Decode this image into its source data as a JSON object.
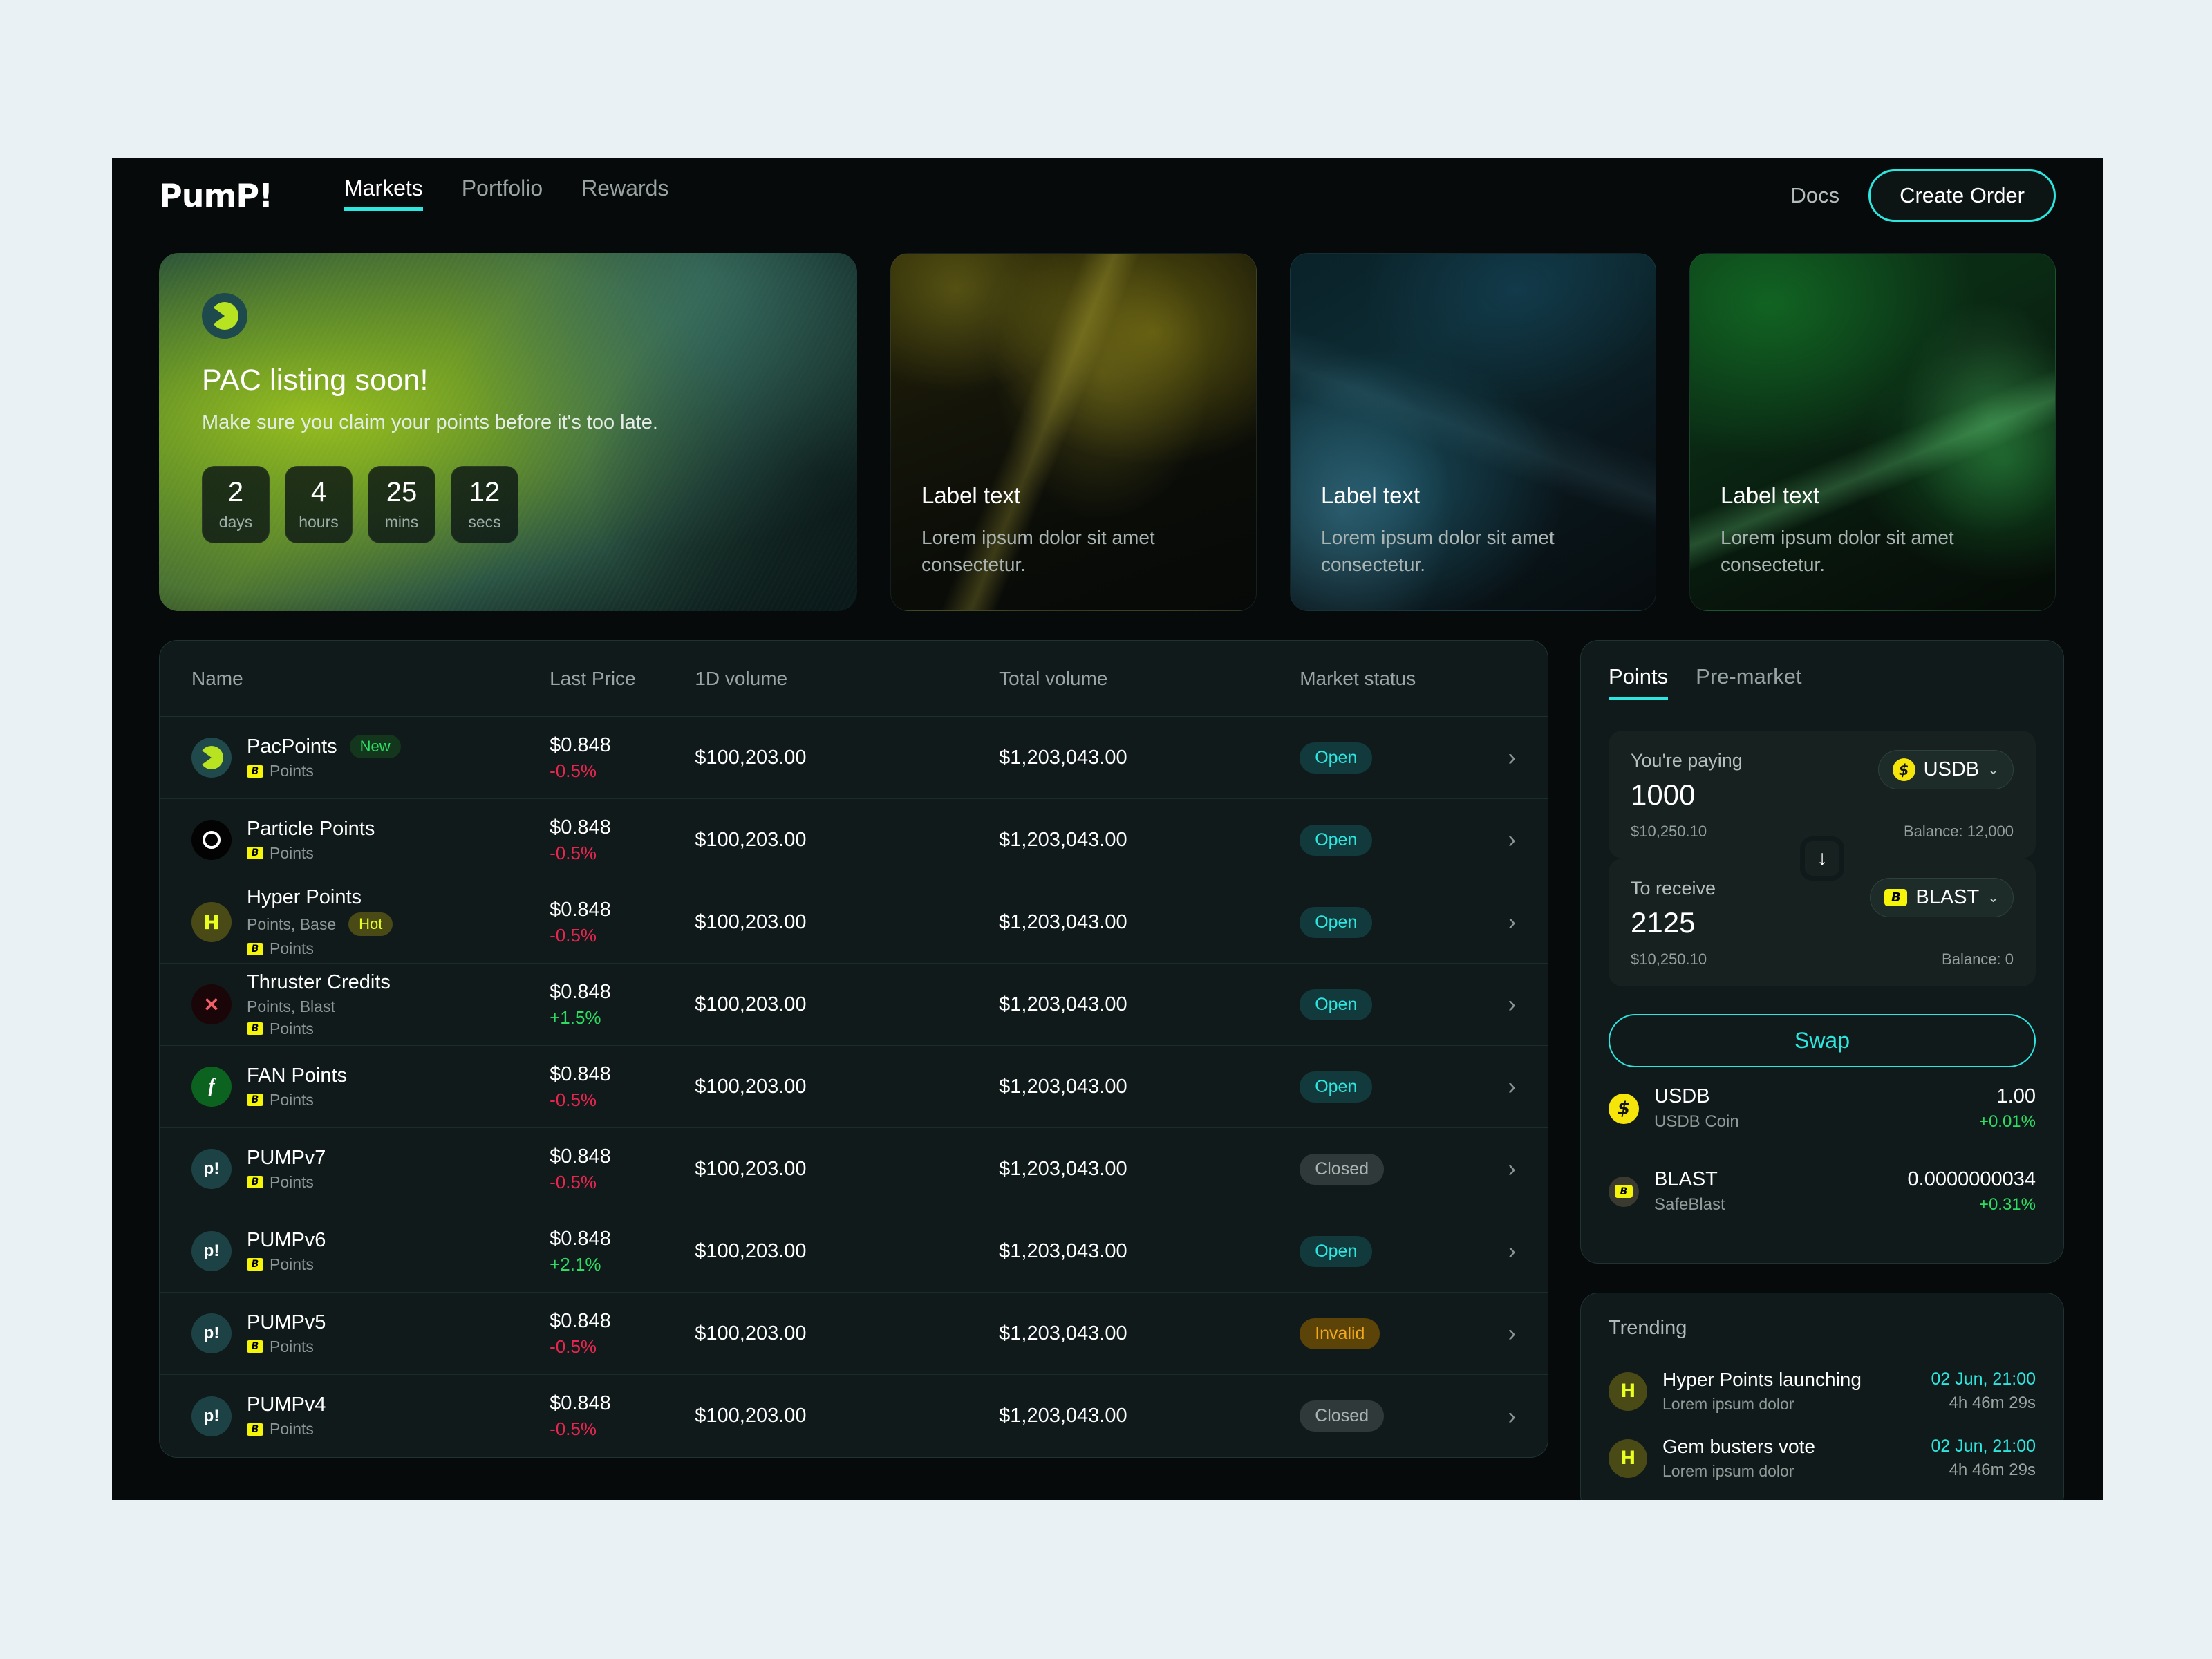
{
  "brand": {
    "logo": "PumP!"
  },
  "nav": {
    "items": [
      {
        "label": "Markets",
        "active": true
      },
      {
        "label": "Portfolio",
        "active": false
      },
      {
        "label": "Rewards",
        "active": false
      }
    ],
    "docs_label": "Docs",
    "create_order_label": "Create Order"
  },
  "hero": {
    "title": "PAC listing soon!",
    "subtitle": "Make sure you claim your points before it's too late.",
    "countdown": [
      {
        "value": "2",
        "unit": "days"
      },
      {
        "value": "4",
        "unit": "hours"
      },
      {
        "value": "25",
        "unit": "mins"
      },
      {
        "value": "12",
        "unit": "secs"
      }
    ],
    "cards": [
      {
        "label": "Label text",
        "desc": "Lorem ipsum dolor sit amet consectetur."
      },
      {
        "label": "Label text",
        "desc": "Lorem ipsum dolor sit amet consectetur."
      },
      {
        "label": "Label text",
        "desc": "Lorem ipsum dolor sit amet consectetur."
      }
    ]
  },
  "table": {
    "headers": {
      "name": "Name",
      "last_price": "Last Price",
      "one_d_volume": "1D  volume",
      "total_volume": "Total volume",
      "market_status": "Market status"
    },
    "rows": [
      {
        "name": "PacPoints",
        "tag": "New",
        "sub": "",
        "chain": "Points",
        "price": "$0.848",
        "change": "-0.5%",
        "dir": "down",
        "vol1d": "$100,203.00",
        "voltotal": "$1,203,043.00",
        "status": "Open"
      },
      {
        "name": "Particle Points",
        "tag": "",
        "sub": "",
        "chain": "Points",
        "price": "$0.848",
        "change": "-0.5%",
        "dir": "down",
        "vol1d": "$100,203.00",
        "voltotal": "$1,203,043.00",
        "status": "Open"
      },
      {
        "name": "Hyper Points",
        "tag": "Hot",
        "sub": "Points, Base",
        "chain": "Points",
        "price": "$0.848",
        "change": "-0.5%",
        "dir": "down",
        "vol1d": "$100,203.00",
        "voltotal": "$1,203,043.00",
        "status": "Open"
      },
      {
        "name": "Thruster Credits",
        "tag": "",
        "sub": "Points, Blast",
        "chain": "Points",
        "price": "$0.848",
        "change": "+1.5%",
        "dir": "up",
        "vol1d": "$100,203.00",
        "voltotal": "$1,203,043.00",
        "status": "Open"
      },
      {
        "name": "FAN Points",
        "tag": "",
        "sub": "",
        "chain": "Points",
        "price": "$0.848",
        "change": "-0.5%",
        "dir": "down",
        "vol1d": "$100,203.00",
        "voltotal": "$1,203,043.00",
        "status": "Open"
      },
      {
        "name": "PUMPv7",
        "tag": "",
        "sub": "",
        "chain": "Points",
        "price": "$0.848",
        "change": "-0.5%",
        "dir": "down",
        "vol1d": "$100,203.00",
        "voltotal": "$1,203,043.00",
        "status": "Closed"
      },
      {
        "name": "PUMPv6",
        "tag": "",
        "sub": "",
        "chain": "Points",
        "price": "$0.848",
        "change": "+2.1%",
        "dir": "up",
        "vol1d": "$100,203.00",
        "voltotal": "$1,203,043.00",
        "status": "Open"
      },
      {
        "name": "PUMPv5",
        "tag": "",
        "sub": "",
        "chain": "Points",
        "price": "$0.848",
        "change": "-0.5%",
        "dir": "down",
        "vol1d": "$100,203.00",
        "voltotal": "$1,203,043.00",
        "status": "Invalid"
      },
      {
        "name": "PUMPv4",
        "tag": "",
        "sub": "",
        "chain": "Points",
        "price": "$0.848",
        "change": "-0.5%",
        "dir": "down",
        "vol1d": "$100,203.00",
        "voltotal": "$1,203,043.00",
        "status": "Closed"
      }
    ]
  },
  "swap": {
    "tabs": [
      {
        "label": "Points",
        "active": true
      },
      {
        "label": "Pre-market",
        "active": false
      }
    ],
    "pay": {
      "label": "You're paying",
      "amount": "1000",
      "usd": "$10,250.10",
      "balance": "Balance: 12,000",
      "token": "USDB"
    },
    "receive": {
      "label": "To receive",
      "amount": "2125",
      "usd": "$10,250.10",
      "balance": "Balance: 0",
      "token": "BLAST"
    },
    "swap_button": "Swap",
    "tokens": [
      {
        "symbol": "USDB",
        "name": "USDB Coin",
        "price": "1.00",
        "change": "+0.01%"
      },
      {
        "symbol": "BLAST",
        "name": "SafeBlast",
        "price": "0.0000000034",
        "change": "+0.31%"
      }
    ]
  },
  "trending": {
    "title": "Trending",
    "items": [
      {
        "title": "Hyper Points launching",
        "sub": "Lorem ipsum dolor",
        "date": "02 Jun, 21:00",
        "countdown": "4h 46m 29s"
      },
      {
        "title": "Gem busters vote",
        "sub": "Lorem ipsum dolor",
        "date": "02 Jun, 21:00",
        "countdown": "4h 46m 29s"
      }
    ]
  },
  "icons": {
    "chevron_right": "›",
    "chevron_down": "⌄",
    "arrow_down": "↓",
    "blast_mark": "B",
    "hyper_mark": "H",
    "fan_mark": "f",
    "pump_mark": "p!",
    "usdb_mark": "$"
  },
  "colors": {
    "accent": "#2ee6e0",
    "up": "#2ddc62",
    "down": "#e8254f",
    "warn": "#f2a81c",
    "brand_yellow": "#e8ff1f",
    "page_bg": "#e9f1f5",
    "app_bg": "#070a0a",
    "card_bg": "#101a1a"
  }
}
